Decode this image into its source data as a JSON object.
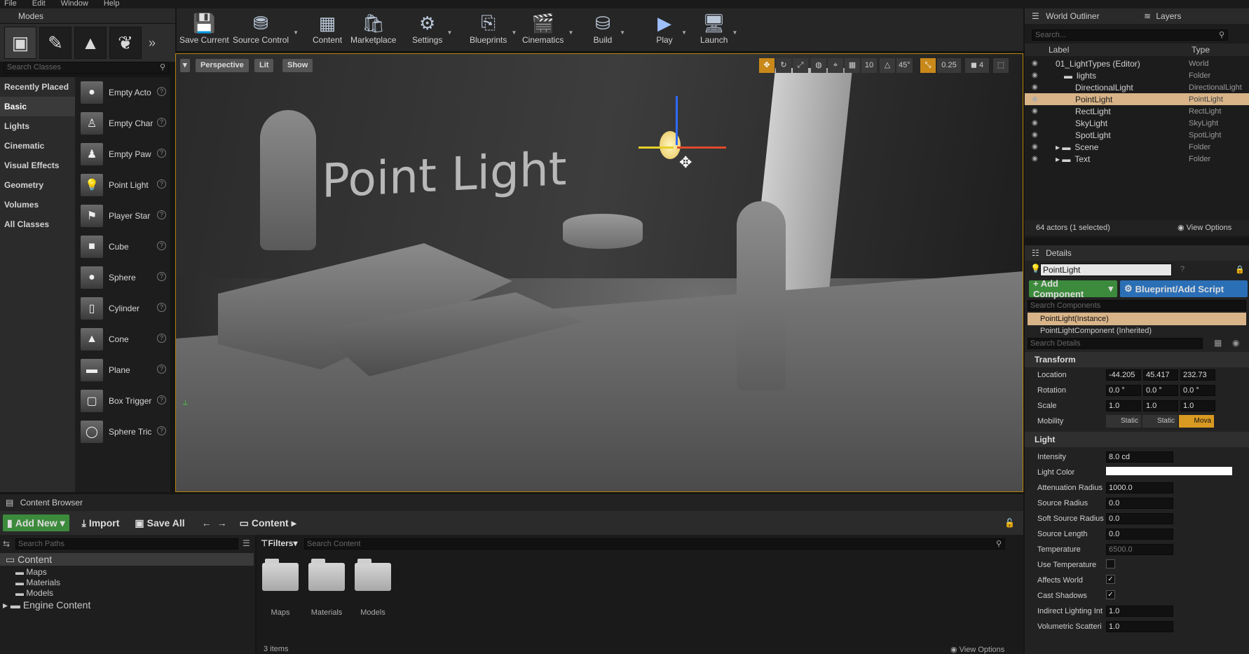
{
  "menu": [
    "File",
    "Edit",
    "Window",
    "Help"
  ],
  "modes": {
    "tab": "Modes",
    "search_placeholder": "Search Classes",
    "categories": [
      "Recently Placed",
      "Basic",
      "Lights",
      "Cinematic",
      "Visual Effects",
      "Geometry",
      "Volumes",
      "All Classes"
    ],
    "items": [
      "Empty Acto",
      "Empty Char",
      "Empty Paw",
      "Point Light",
      "Player Star",
      "Cube",
      "Sphere",
      "Cylinder",
      "Cone",
      "Plane",
      "Box Trigger",
      "Sphere Tric"
    ]
  },
  "toolbar": [
    "Save Current",
    "Source Control",
    "Content",
    "Marketplace",
    "Settings",
    "Blueprints",
    "Cinematics",
    "Build",
    "Play",
    "Launch"
  ],
  "viewport": {
    "perspective": "Perspective",
    "lit": "Lit",
    "show": "Show",
    "grid": "10",
    "angle": "45°",
    "scale": "0.25",
    "speed": "4",
    "scene_text": "Point Light"
  },
  "outliner": {
    "tab": "World Outliner",
    "layers": "Layers",
    "search_placeholder": "Search...",
    "col_label": "Label",
    "col_type": "Type",
    "rows": [
      {
        "label": "01_LightTypes (Editor)",
        "type": "World"
      },
      {
        "label": "lights",
        "type": "Folder"
      },
      {
        "label": "DirectionalLight",
        "type": "DirectionalLight"
      },
      {
        "label": "PointLight",
        "type": "PointLight"
      },
      {
        "label": "RectLight",
        "type": "RectLight"
      },
      {
        "label": "SkyLight",
        "type": "SkyLight"
      },
      {
        "label": "SpotLight",
        "type": "SpotLight"
      },
      {
        "label": "Scene",
        "type": "Folder"
      },
      {
        "label": "Text",
        "type": "Folder"
      }
    ],
    "status": "64 actors (1 selected)",
    "view_options": "View Options"
  },
  "details": {
    "tab": "Details",
    "name": "PointLight",
    "add_component": "+ Add Component",
    "blueprint": "Blueprint/Add Script",
    "search_components": "Search Components",
    "instance": "PointLight(Instance)",
    "component": "PointLightComponent (Inherited)",
    "search_details": "Search Details",
    "transform": "Transform",
    "location_label": "Location",
    "location": [
      "-44.205",
      "45.417",
      "232.73"
    ],
    "rotation_label": "Rotation",
    "rotation": [
      "0.0 °",
      "0.0 °",
      "0.0 °"
    ],
    "scale_label": "Scale",
    "scale": [
      "1.0",
      "1.0",
      "1.0"
    ],
    "mobility_label": "Mobility",
    "mobility": [
      "Static",
      "Static",
      "Mova"
    ],
    "light": "Light",
    "intensity_label": "Intensity",
    "intensity": "8.0 cd",
    "light_color_label": "Light Color",
    "attenuation_label": "Attenuation Radius",
    "attenuation": "1000.0",
    "source_radius_label": "Source Radius",
    "source_radius": "0.0",
    "soft_source_label": "Soft Source Radius",
    "soft_source": "0.0",
    "source_length_label": "Source Length",
    "source_length": "0.0",
    "temperature_label": "Temperature",
    "temperature": "6500.0",
    "use_temp_label": "Use Temperature",
    "affects_world_label": "Affects World",
    "cast_shadows_label": "Cast Shadows",
    "indirect_label": "Indirect Lighting Int",
    "indirect": "1.0",
    "volumetric_label": "Volumetric Scatteri",
    "volumetric": "1.0"
  },
  "content": {
    "tab": "Content Browser",
    "add_new": "Add New",
    "import": "Import",
    "save_all": "Save All",
    "path": "Content",
    "search_paths": "Search Paths",
    "filters": "Filters",
    "search_content": "Search Content",
    "tree": [
      "Content",
      "Maps",
      "Materials",
      "Models",
      "Engine Content"
    ],
    "folders": [
      "Maps",
      "Materials",
      "Models"
    ],
    "count": "3 items",
    "view_options": "View Options"
  }
}
